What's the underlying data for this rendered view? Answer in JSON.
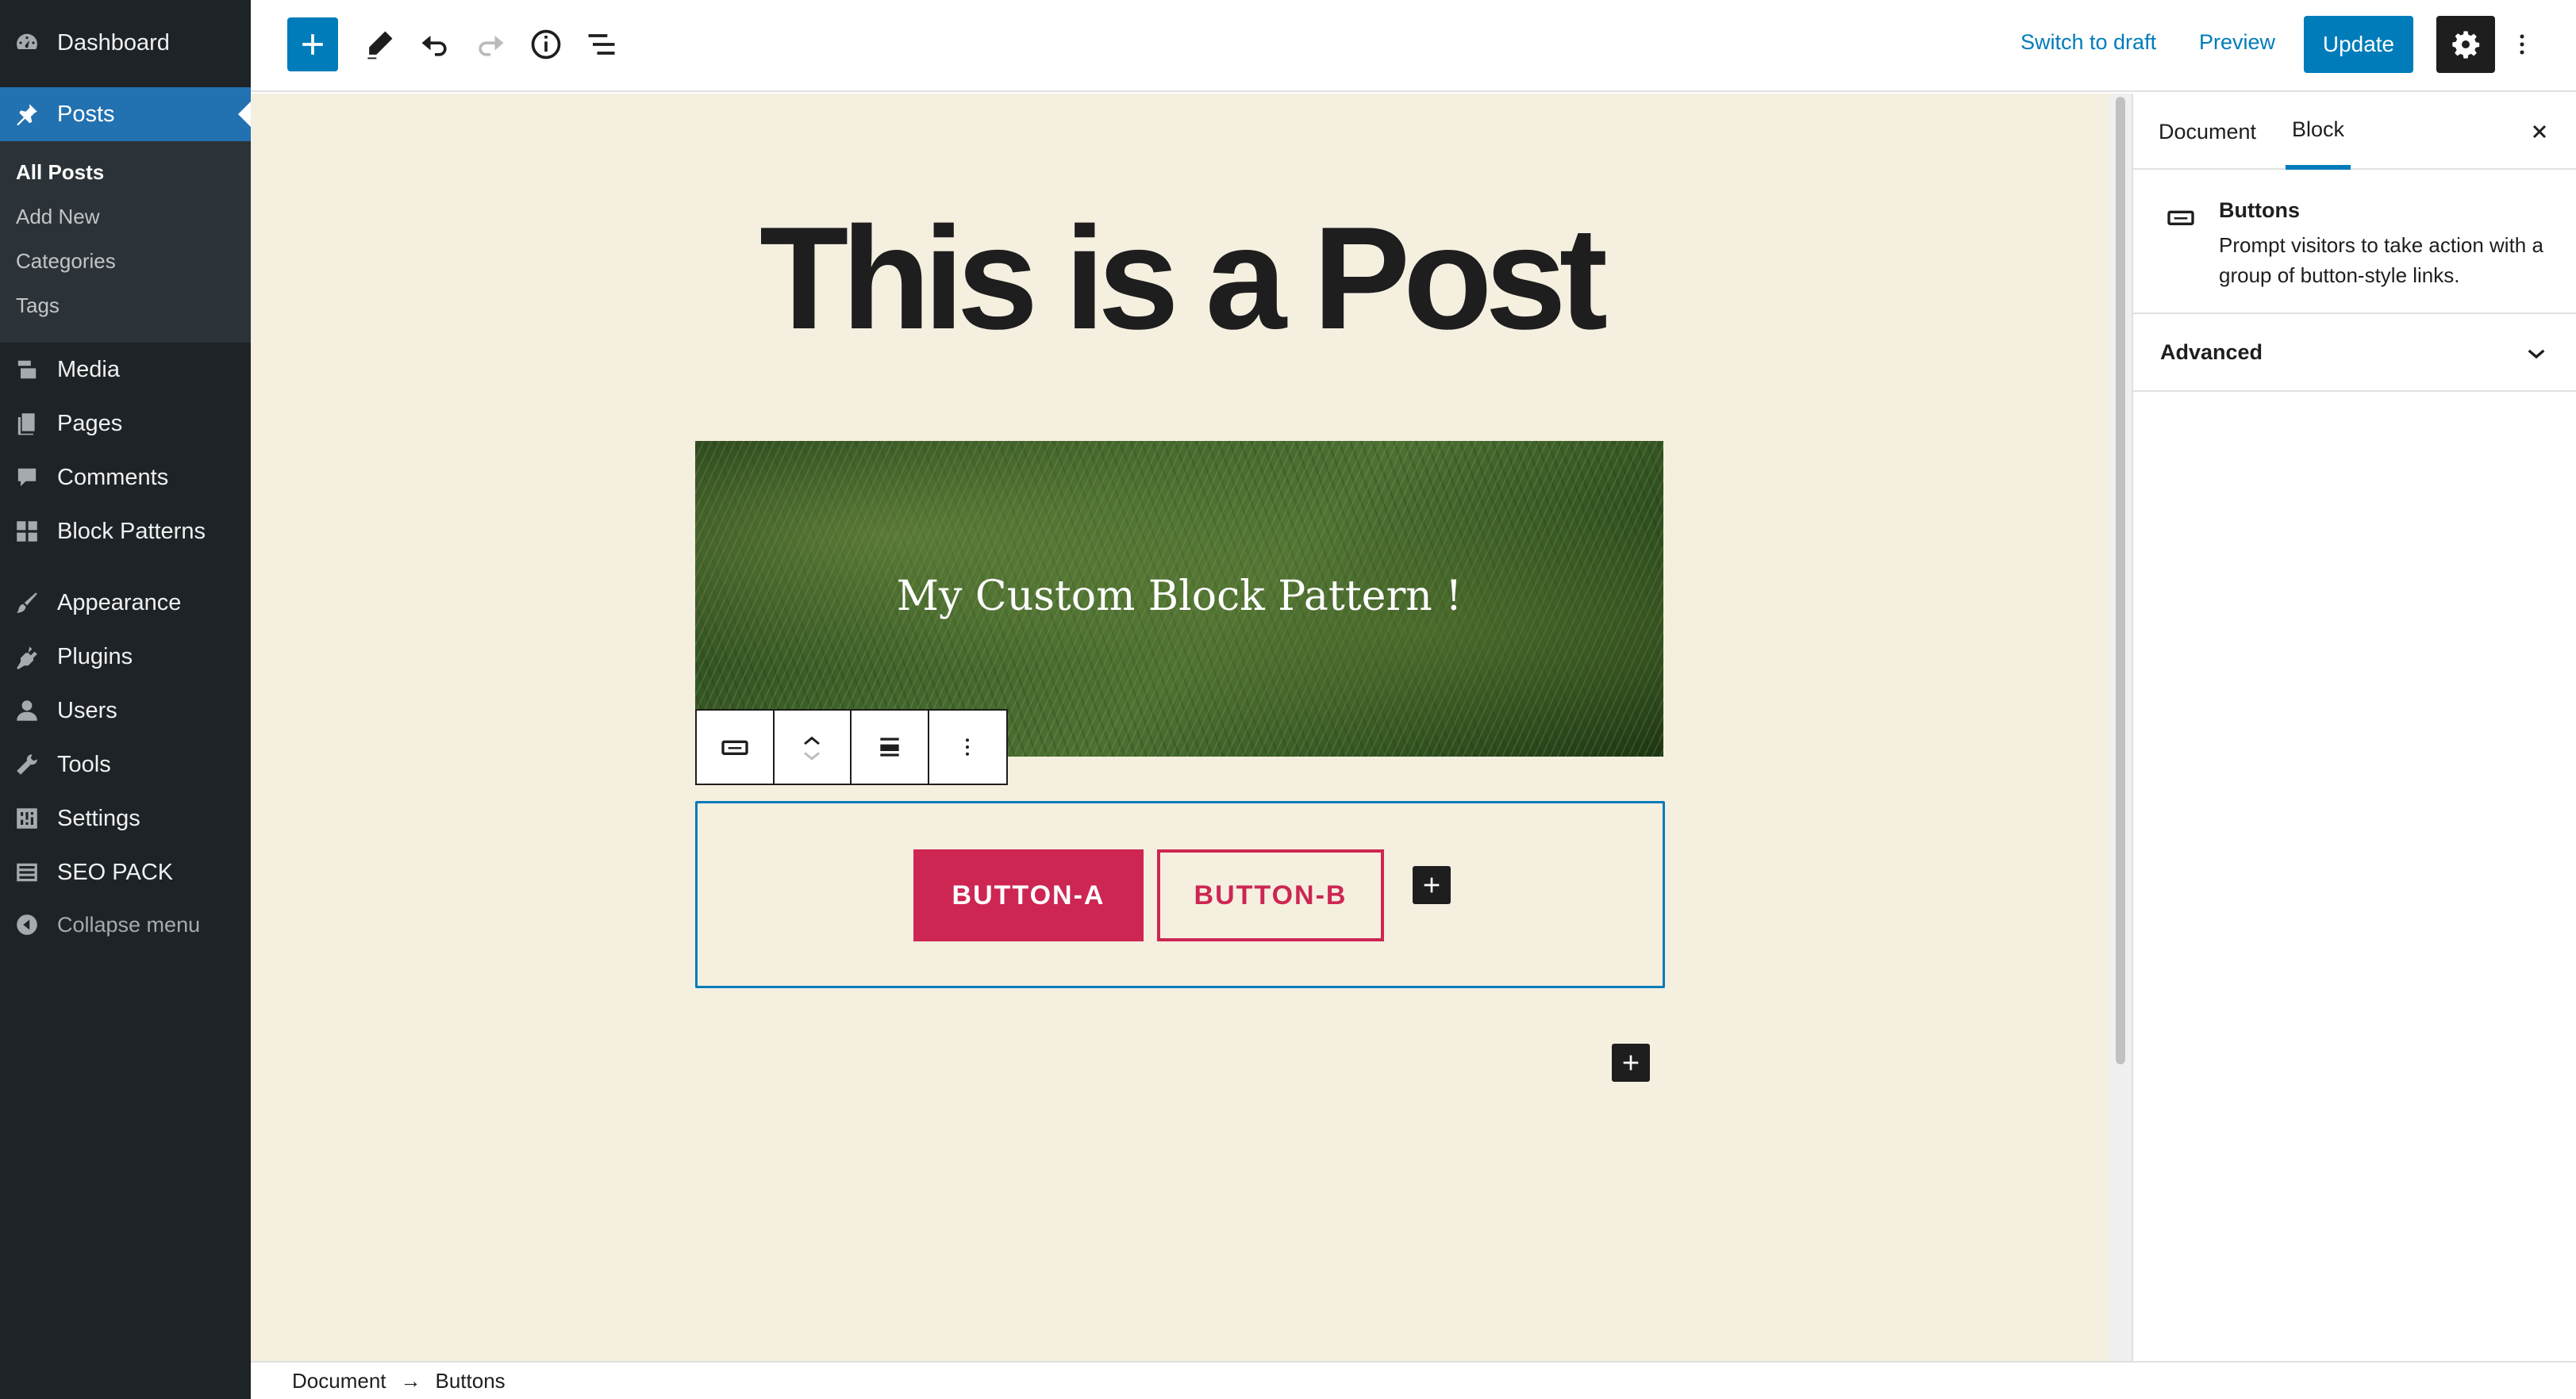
{
  "admin_menu": {
    "items": [
      {
        "label": "Dashboard",
        "icon": "dashboard-icon"
      },
      {
        "label": "Posts",
        "icon": "pin-icon"
      },
      {
        "label": "Media",
        "icon": "media-icon"
      },
      {
        "label": "Pages",
        "icon": "page-icon"
      },
      {
        "label": "Comments",
        "icon": "comment-icon"
      },
      {
        "label": "Block Patterns",
        "icon": "grid-icon"
      },
      {
        "label": "Appearance",
        "icon": "brush-icon"
      },
      {
        "label": "Plugins",
        "icon": "plugin-icon"
      },
      {
        "label": "Users",
        "icon": "user-icon"
      },
      {
        "label": "Tools",
        "icon": "wrench-icon"
      },
      {
        "label": "Settings",
        "icon": "settings-icon"
      },
      {
        "label": "SEO PACK",
        "icon": "list-icon"
      }
    ],
    "posts_submenu": [
      "All Posts",
      "Add New",
      "Categories",
      "Tags"
    ],
    "collapse_label": "Collapse menu"
  },
  "toolbar": {
    "switch_to_draft": "Switch to draft",
    "preview": "Preview",
    "update": "Update"
  },
  "editor": {
    "post_title": "This is a Post",
    "cover_text": "My Custom Block Pattern !",
    "buttons": [
      "BUTTON-A",
      "BUTTON-B"
    ]
  },
  "breadcrumb": [
    "Document",
    "Buttons"
  ],
  "sidebar": {
    "tabs": [
      "Document",
      "Block"
    ],
    "active_tab": "Block",
    "block_card": {
      "title": "Buttons",
      "description": "Prompt visitors to take action with a group of button-style links."
    },
    "panels": [
      "Advanced"
    ]
  },
  "colors": {
    "accent": "#007cba",
    "admin_bg": "#1d2327",
    "button_red": "#cd2653",
    "canvas_bg": "#f5efe0"
  }
}
